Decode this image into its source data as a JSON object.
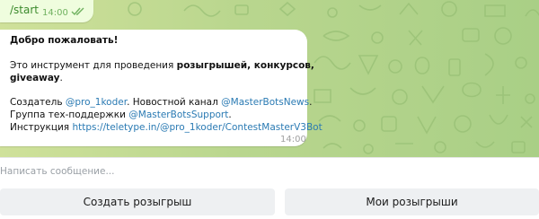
{
  "chat": {
    "outgoing": {
      "text": "/start",
      "time": "14:00",
      "status_icon": "double-check-icon"
    },
    "incoming": {
      "title": "Добро пожаловать!",
      "line1_prefix": "Это инструмент для проведения ",
      "line1_bold": "розыгрышей, конкурсов,",
      "line2_bold": "giveaway",
      "line2_suffix": ".",
      "creator_label": "Создатель ",
      "creator_link": "@pro_1koder",
      "news_label": ". Новостной канал ",
      "news_link": "@MasterBotsNews",
      "news_suffix": ".",
      "support_label": "Группа тех-поддержки ",
      "support_link": "@MasterBotsSupport",
      "support_suffix": ".",
      "guide_label": "Инструкция ",
      "guide_link": "https://teletype.in/@pro_1koder/ContestMasterV3Bot",
      "time": "14:00"
    }
  },
  "composer": {
    "placeholder": "Написать сообщение..."
  },
  "keyboard": {
    "buttons": [
      {
        "label": "Создать розыгрыш"
      },
      {
        "label": "Мои розыгрыши"
      }
    ]
  },
  "colors": {
    "background": "#b9d68e",
    "outgoing_bubble": "#effdde",
    "incoming_bubble": "#ffffff",
    "link": "#2a7ab3",
    "keyboard_button": "#eef0f2"
  }
}
